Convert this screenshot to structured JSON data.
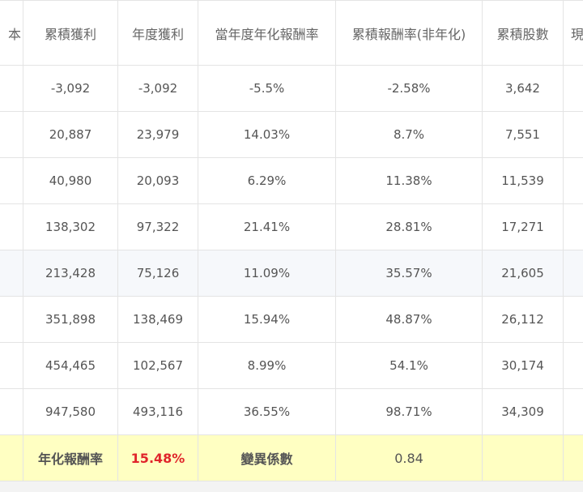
{
  "table": {
    "headers": [
      "本",
      "累積獲利",
      "年度獲利",
      "當年度年化報酬率",
      "累積報酬率(非年化)",
      "累積股數",
      "現"
    ],
    "rows": [
      [
        "",
        "-3,092",
        "-3,092",
        "-5.5%",
        "-2.58%",
        "3,642",
        ""
      ],
      [
        "",
        "20,887",
        "23,979",
        "14.03%",
        "8.7%",
        "7,551",
        ""
      ],
      [
        "",
        "40,980",
        "20,093",
        "6.29%",
        "11.38%",
        "11,539",
        ""
      ],
      [
        "",
        "138,302",
        "97,322",
        "21.41%",
        "28.81%",
        "17,271",
        ""
      ],
      [
        "",
        "213,428",
        "75,126",
        "11.09%",
        "35.57%",
        "21,605",
        ""
      ],
      [
        "",
        "351,898",
        "138,469",
        "15.94%",
        "48.87%",
        "26,112",
        ""
      ],
      [
        "",
        "454,465",
        "102,567",
        "8.99%",
        "54.1%",
        "30,174",
        ""
      ],
      [
        "",
        "947,580",
        "493,116",
        "36.55%",
        "98.71%",
        "34,309",
        ""
      ]
    ],
    "highlight_row_index": 4,
    "footer": {
      "annual_return_label": "年化報酬率",
      "annual_return_value": "15.48%",
      "cv_label": "變異係數",
      "cv_value": "0.84"
    }
  },
  "colors": {
    "footer_bg": "#ffffc2",
    "annual_return_value": "#e0252b",
    "highlight_row_bg": "#f6f8fb",
    "page_bg": "#f3f3f3"
  }
}
